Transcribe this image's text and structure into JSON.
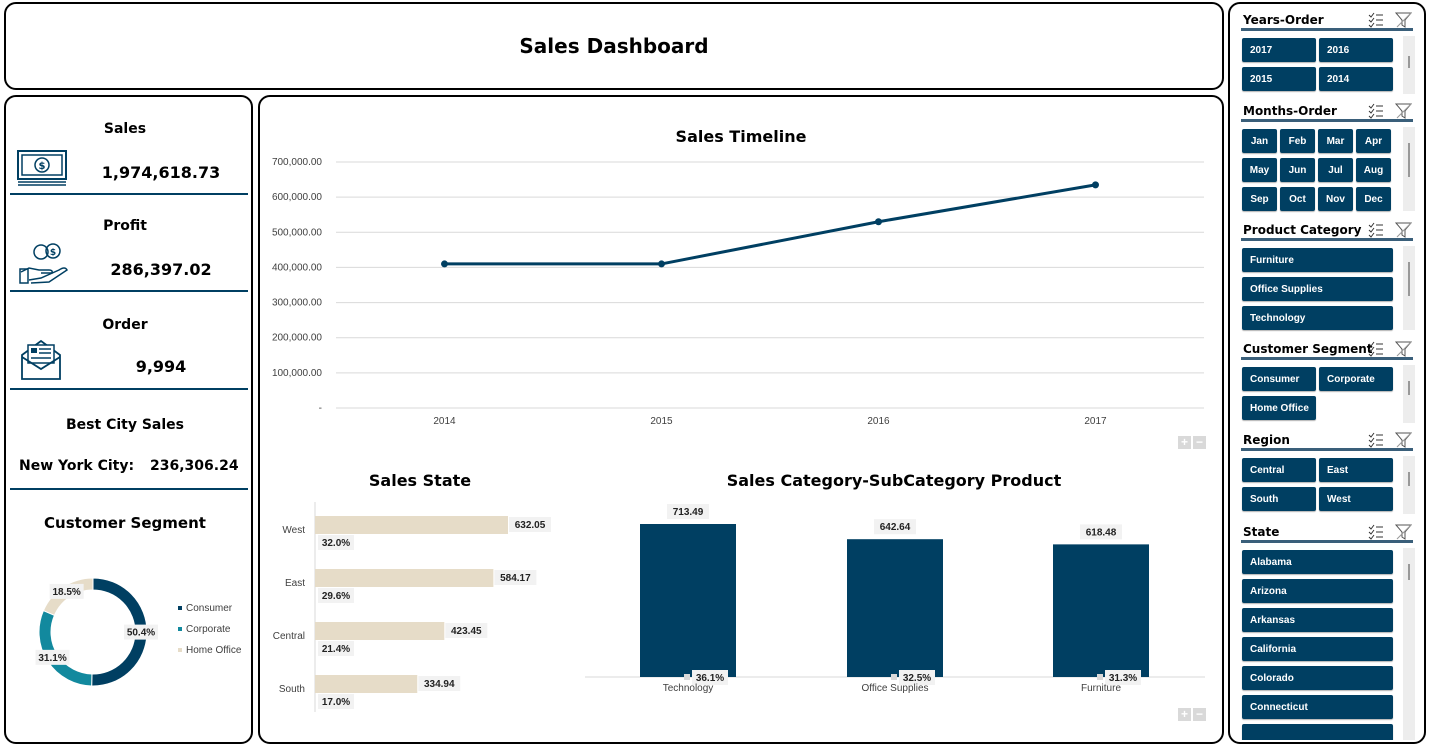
{
  "dashboard": {
    "title": "Sales Dashboard"
  },
  "colors": {
    "navy": "#003f62",
    "teal": "#12899e",
    "beige": "#e6dcc8",
    "separator": "#003f62"
  },
  "kpis": {
    "sales": {
      "label": "Sales",
      "value": "1,974,618.73",
      "icon": "money-bill-icon"
    },
    "profit": {
      "label": "Profit",
      "value": "286,397.02",
      "icon": "hand-coins-icon"
    },
    "order": {
      "label": "Order",
      "value": "9,994",
      "icon": "envelope-order-icon"
    },
    "best_city": {
      "label": "Best City Sales",
      "city": "New York City:",
      "value": "236,306.24"
    }
  },
  "segment_chart": {
    "title": "Customer Segment",
    "legend": [
      "Consumer",
      "Corporate",
      "Home Office"
    ]
  },
  "timeline_chart": {
    "title": "Sales Timeline"
  },
  "state_chart": {
    "title": "Sales State"
  },
  "category_chart": {
    "title": "Sales Category-SubCategory Product"
  },
  "chart_data": [
    {
      "type": "pie",
      "title": "Customer Segment",
      "categories": [
        "Consumer",
        "Corporate",
        "Home Office"
      ],
      "values": [
        50.4,
        31.1,
        18.5
      ],
      "labels": [
        "50.4%",
        "31.1%",
        "18.5%"
      ],
      "legend": "right"
    },
    {
      "type": "line",
      "title": "Sales Timeline",
      "x": [
        "2014",
        "2015",
        "2016",
        "2017"
      ],
      "series": [
        {
          "values": [
            410000,
            410000,
            530000,
            635000
          ]
        }
      ],
      "yticks": [
        "-",
        "100,000.00",
        "200,000.00",
        "300,000.00",
        "400,000.00",
        "500,000.00",
        "600,000.00",
        "700,000.00"
      ],
      "ylim": [
        0,
        700000
      ],
      "grid": true
    },
    {
      "type": "bar",
      "title": "Sales State",
      "orientation": "horizontal",
      "categories": [
        "West",
        "East",
        "Central",
        "South"
      ],
      "values": [
        632.05,
        584.17,
        423.45,
        334.94
      ],
      "value_labels": [
        "632.05",
        "584.17",
        "423.45",
        "334.94"
      ],
      "share_labels": [
        "32.0%",
        "29.6%",
        "21.4%",
        "17.0%"
      ]
    },
    {
      "type": "bar",
      "title": "Sales Category-SubCategory Product",
      "categories": [
        "Technology",
        "Office Supplies",
        "Furniture"
      ],
      "values": [
        713.49,
        642.64,
        618.48
      ],
      "value_labels": [
        "713.49",
        "642.64",
        "618.48"
      ],
      "share_labels": [
        "36.1%",
        "32.5%",
        "31.3%"
      ]
    }
  ],
  "slicers": {
    "years": {
      "title": "Years-Order",
      "items": [
        "2017",
        "2016",
        "2015",
        "2014"
      ]
    },
    "months": {
      "title": "Months-Order",
      "items": [
        "Jan",
        "Feb",
        "Mar",
        "Apr",
        "May",
        "Jun",
        "Jul",
        "Aug",
        "Sep",
        "Oct",
        "Nov",
        "Dec"
      ]
    },
    "category": {
      "title": "Product Category",
      "items": [
        "Furniture",
        "Office Supplies",
        "Technology"
      ]
    },
    "segment": {
      "title": "Customer Segment",
      "items": [
        "Consumer",
        "Corporate",
        "Home Office"
      ]
    },
    "region": {
      "title": "Region",
      "items": [
        "Central",
        "East",
        "South",
        "West"
      ]
    },
    "state": {
      "title": "State",
      "items": [
        "Alabama",
        "Arizona",
        "Arkansas",
        "California",
        "Colorado",
        "Connecticut"
      ]
    }
  },
  "zoom": {
    "plus": "+",
    "minus": "−"
  }
}
